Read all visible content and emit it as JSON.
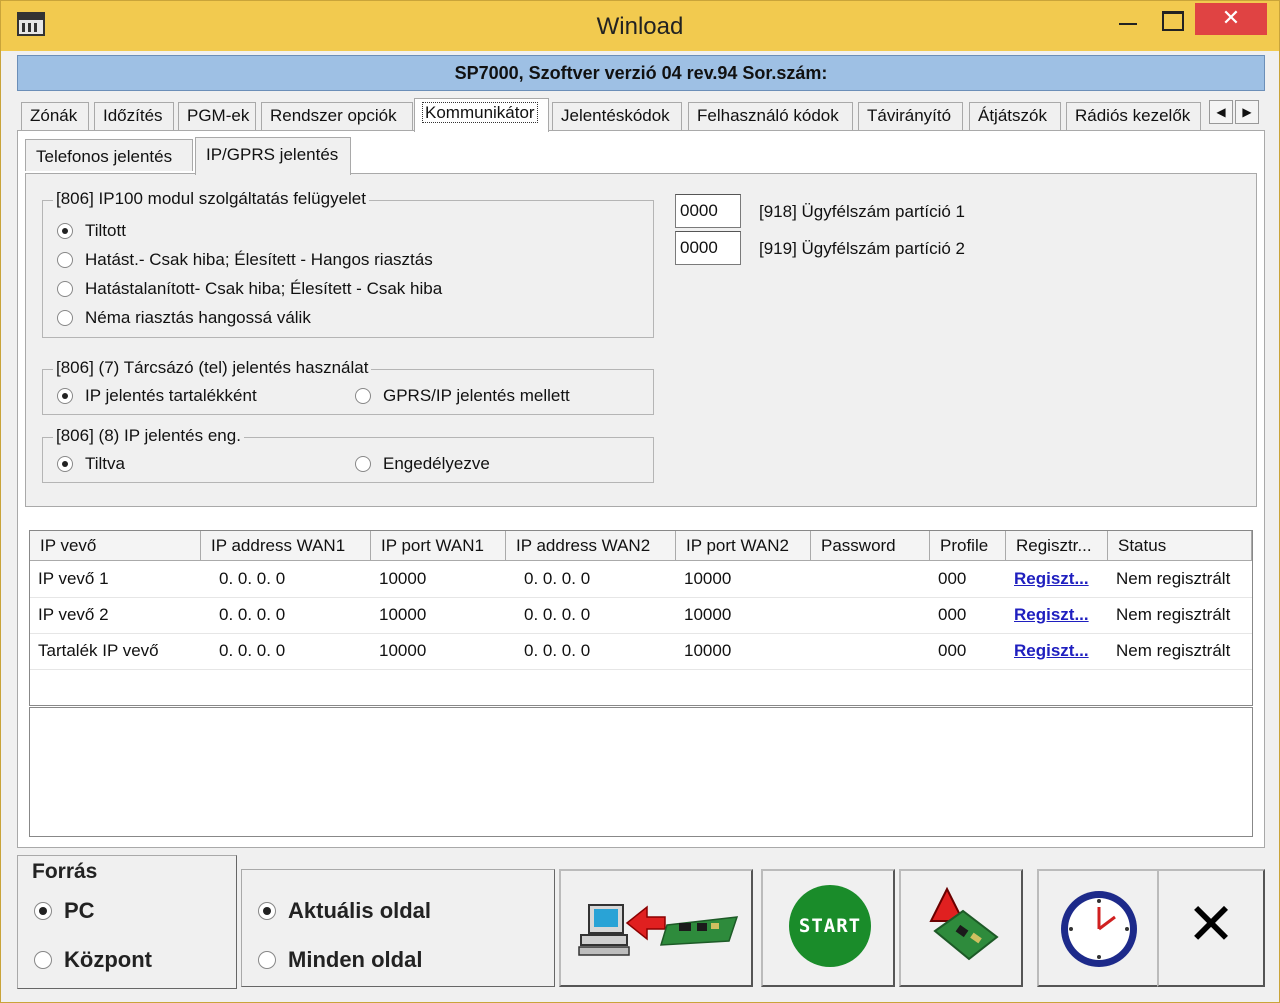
{
  "window": {
    "title": "Winload",
    "close_glyph": "✕"
  },
  "header": {
    "text": "SP7000, Szoftver verzió 04 rev.94 Sor.szám:"
  },
  "main_tabs": [
    {
      "label": "Zónák",
      "active": false
    },
    {
      "label": "Időzítés",
      "active": false
    },
    {
      "label": "PGM-ek",
      "active": false
    },
    {
      "label": "Rendszer opciók",
      "active": false
    },
    {
      "label": "Kommunikátor",
      "active": true
    },
    {
      "label": "Jelentéskódok",
      "active": false
    },
    {
      "label": "Felhasználó kódok",
      "active": false
    },
    {
      "label": "Távirányító",
      "active": false
    },
    {
      "label": "Átjátszók",
      "active": false
    },
    {
      "label": "Rádiós kezelők",
      "active": false
    }
  ],
  "tab_scroll": {
    "left": "◀",
    "right": "▶"
  },
  "sub_tabs": [
    {
      "label": "Telefonos jelentés",
      "active": false
    },
    {
      "label": "IP/GPRS jelentés",
      "active": true
    }
  ],
  "group_supervision": {
    "legend": "[806]  IP100 modul szolgáltatás felügyelet",
    "options": [
      {
        "label": "Tiltott",
        "checked": true
      },
      {
        "label": "Hatást.- Csak hiba; Élesített - Hangos riasztás",
        "checked": false
      },
      {
        "label": "Hatástalanított- Csak hiba; Élesített - Csak hiba",
        "checked": false
      },
      {
        "label": "Néma riasztás hangossá válik",
        "checked": false
      }
    ]
  },
  "group_dialer": {
    "legend": "[806] (7)  Tárcsázó (tel) jelentés használat",
    "options": [
      {
        "label": "IP jelentés tartalékként",
        "checked": true
      },
      {
        "label": "GPRS/IP jelentés mellett",
        "checked": false
      }
    ]
  },
  "group_ip_enable": {
    "legend": "[806] (8)  IP jelentés eng.",
    "options": [
      {
        "label": "Tiltva",
        "checked": true
      },
      {
        "label": "Engedélyezve",
        "checked": false
      }
    ]
  },
  "account_fields": [
    {
      "value": "0000",
      "label": "[918] Ügyfélszám partíció 1"
    },
    {
      "value": "0000",
      "label": "[919] Ügyfélszám partíció 2"
    }
  ],
  "table": {
    "columns": [
      "IP vevő",
      "IP address WAN1",
      "IP port WAN1",
      "IP address WAN2",
      "IP port WAN2",
      "Password",
      "Profile",
      "Regisztr...",
      "Status"
    ],
    "rows": [
      [
        "IP vevő 1",
        "0.  0.  0.  0",
        "10000",
        "0.  0.  0.  0",
        "10000",
        "",
        "000",
        "Regiszt...",
        "Nem regisztrált"
      ],
      [
        "IP vevő 2",
        "0.  0.  0.  0",
        "10000",
        "0.  0.  0.  0",
        "10000",
        "",
        "000",
        "Regiszt...",
        "Nem regisztrált"
      ],
      [
        "Tartalék IP vevő",
        "0.  0.  0.  0",
        "10000",
        "0.  0.  0.  0",
        "10000",
        "",
        "000",
        "Regiszt...",
        "Nem regisztrált"
      ]
    ]
  },
  "bottom": {
    "source_label": "Forrás",
    "source_options": [
      {
        "label": "PC",
        "checked": true
      },
      {
        "label": "Központ",
        "checked": false
      }
    ],
    "page_options": [
      {
        "label": "Aktuális oldal",
        "checked": true
      },
      {
        "label": "Minden oldal",
        "checked": false
      }
    ],
    "start_label": "START",
    "exit_glyph": "✕"
  },
  "colors": {
    "title_bar": "#f2ca4f",
    "header_band": "#9ec0e4",
    "close_button": "#e04343",
    "link": "#1f1fbf",
    "start_button": "#1a8c2a"
  }
}
